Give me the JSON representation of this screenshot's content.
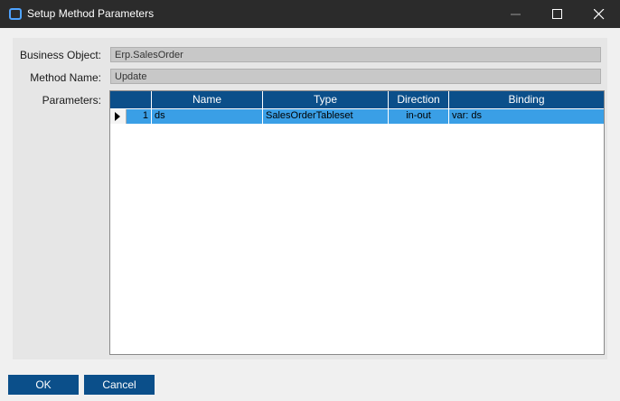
{
  "window": {
    "title": "Setup Method Parameters"
  },
  "form": {
    "business_object_label": "Business Object:",
    "business_object_value": "Erp.SalesOrder",
    "method_name_label": "Method Name:",
    "method_name_value": "Update",
    "parameters_label": "Parameters:"
  },
  "grid": {
    "columns": [
      "Name",
      "Type",
      "Direction",
      "Binding"
    ],
    "rows": [
      {
        "index": "1",
        "name": "ds",
        "type": "SalesOrderTableset",
        "direction": "in-out",
        "binding": "var: ds"
      }
    ]
  },
  "buttons": {
    "ok": "OK",
    "cancel": "Cancel"
  },
  "colors": {
    "title_bar": "#2b2b2b",
    "header": "#0b4f8a",
    "selected_row": "#3a9fe6",
    "button": "#0b4f8a"
  },
  "icons": [
    "app-icon",
    "minimize-icon",
    "maximize-icon",
    "close-icon",
    "row-pointer-icon"
  ]
}
